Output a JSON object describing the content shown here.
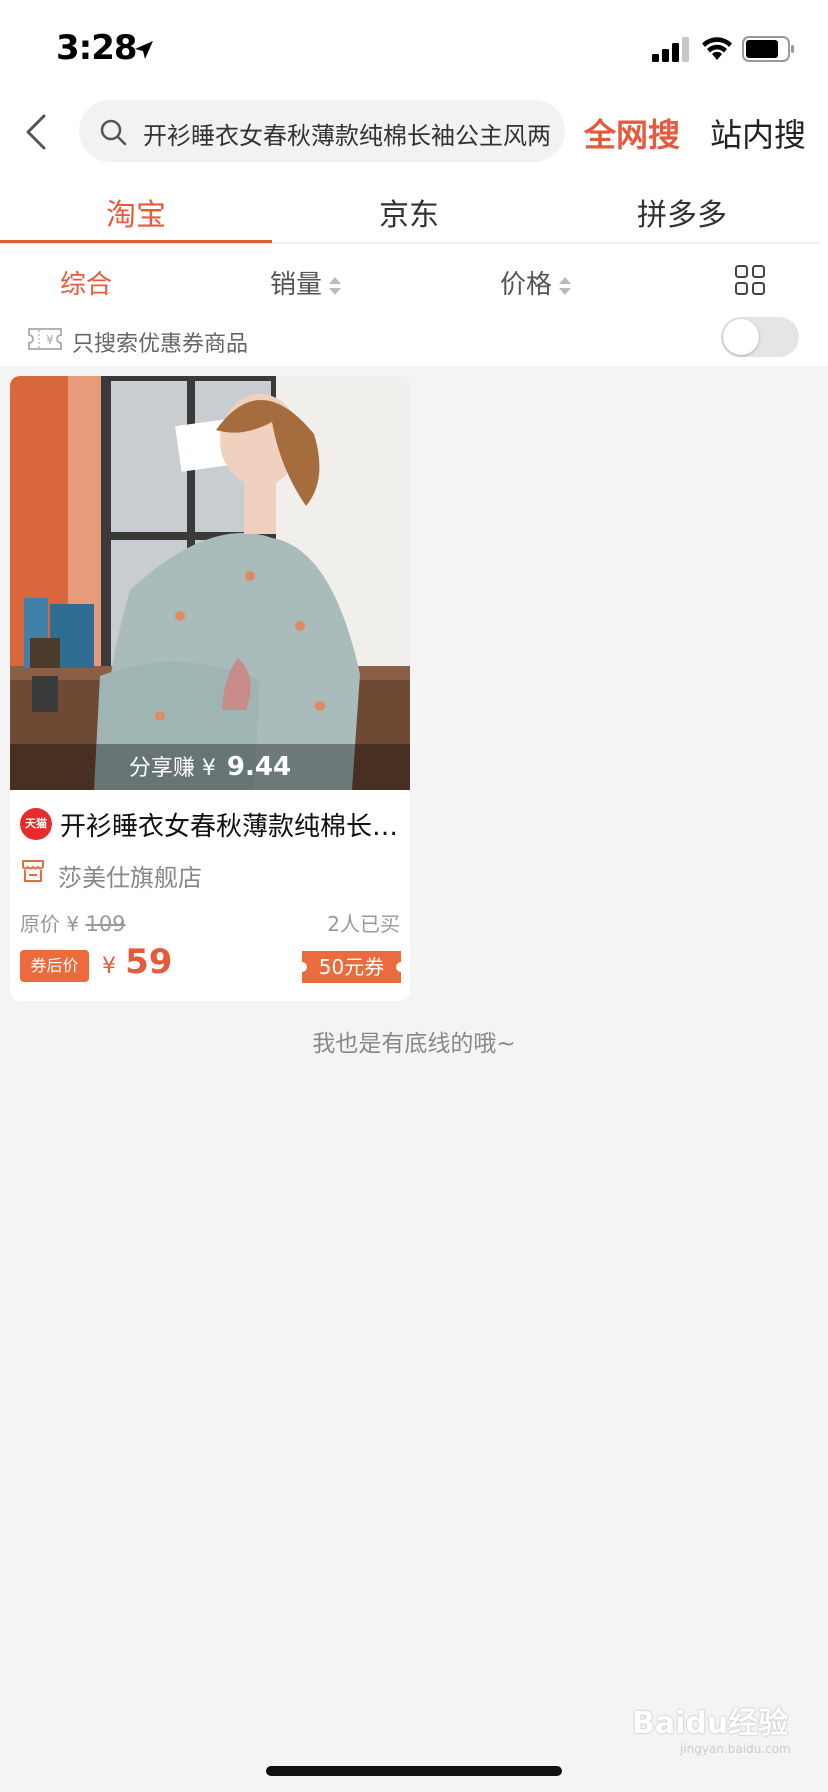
{
  "status_bar": {
    "time": "3:28"
  },
  "search": {
    "query": "开衫睡衣女春秋薄款纯棉长袖公主风两",
    "all_web_label": "全网搜",
    "in_site_label": "站内搜"
  },
  "platform_tabs": [
    {
      "label": "淘宝",
      "selected": true
    },
    {
      "label": "京东",
      "selected": false
    },
    {
      "label": "拼多多",
      "selected": false
    }
  ],
  "sort": {
    "comprehensive": "综合",
    "sales": "销量",
    "price": "价格",
    "layout_icon": "grid-icon"
  },
  "coupon_filter": {
    "label": "只搜索优惠券商品",
    "enabled": false
  },
  "product": {
    "share_prefix": "分享赚",
    "share_yen": "¥",
    "share_amount": "9.44",
    "badge": "天猫",
    "title": "开衫睡衣女春秋薄款纯棉长袖公主风两件套",
    "store": "莎美仕旗舰店",
    "original_label": "原价",
    "original_yen": "¥",
    "original_price": "109",
    "sold": "2人已买",
    "after_coupon_label": "券后价",
    "final_yen": "¥",
    "final_price": "59",
    "coupon": "50元券"
  },
  "footer": {
    "end_text": "我也是有底线的哦~"
  },
  "watermark": {
    "text": "Baidu经验",
    "url": "jingyan.baidu.com"
  },
  "colors": {
    "accent": "#e55b3c",
    "coupon": "#ec6b3c",
    "background": "#f4f4f4"
  }
}
